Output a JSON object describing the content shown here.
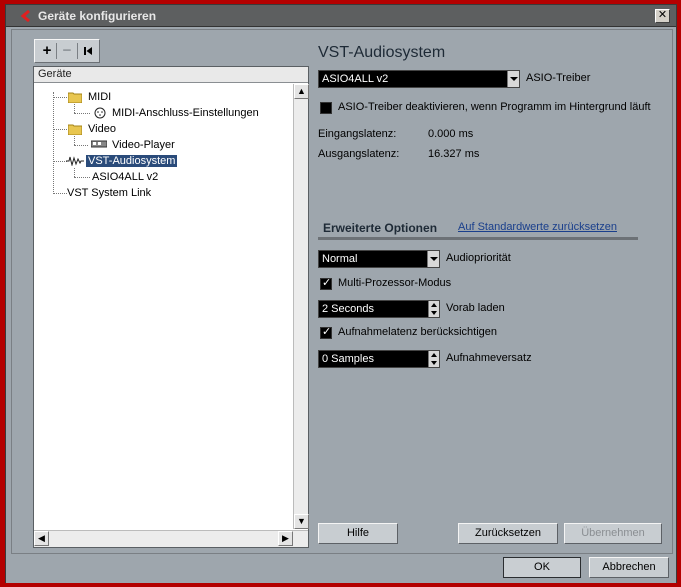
{
  "window": {
    "title": "Geräte konfigurieren"
  },
  "toolbar": {
    "add": "+",
    "remove": "−",
    "reset": "⏮"
  },
  "tree": {
    "header": "Geräte",
    "items": {
      "midi": "MIDI",
      "midi_port": "MIDI-Anschluss-Einstellungen",
      "video": "Video",
      "video_player": "Video-Player",
      "vst_audio": "VST-Audiosystem",
      "asio4all": "ASIO4ALL v2",
      "vst_link": "VST System Link"
    },
    "selected": "vst_audio"
  },
  "panel": {
    "title": "VST-Audiosystem",
    "driver_select": "ASIO4ALL v2",
    "driver_label": "ASIO-Treiber",
    "deactivate_label": "ASIO-Treiber deaktivieren, wenn Programm im Hintergrund läuft",
    "deactivate_checked": false,
    "input_latency_label": "Eingangslatenz:",
    "input_latency_value": "0.000 ms",
    "output_latency_label": "Ausgangslatenz:",
    "output_latency_value": "16.327 ms",
    "tab_advanced": "Erweiterte Optionen",
    "tab_defaults": "Auf Standardwerte zurücksetzen",
    "priority_select": "Normal",
    "priority_label": "Audiopriorität",
    "multiprocessor_label": "Multi-Prozessor-Modus",
    "multiprocessor_checked": true,
    "preload_value": "2 Seconds",
    "preload_label": "Vorab laden",
    "record_latency_label": "Aufnahmelatenz berücksichtigen",
    "record_latency_checked": true,
    "record_offset_value": "0 Samples",
    "record_offset_label": "Aufnahmeversatz"
  },
  "buttons": {
    "help": "Hilfe",
    "reset": "Zurücksetzen",
    "apply": "Übernehmen",
    "ok": "OK",
    "cancel": "Abbrechen"
  },
  "colors": {
    "window_bg": "#9ea6ad",
    "titlebar": "#5d5f60",
    "selection": "#2a4b7a",
    "frame": "#b40000"
  }
}
